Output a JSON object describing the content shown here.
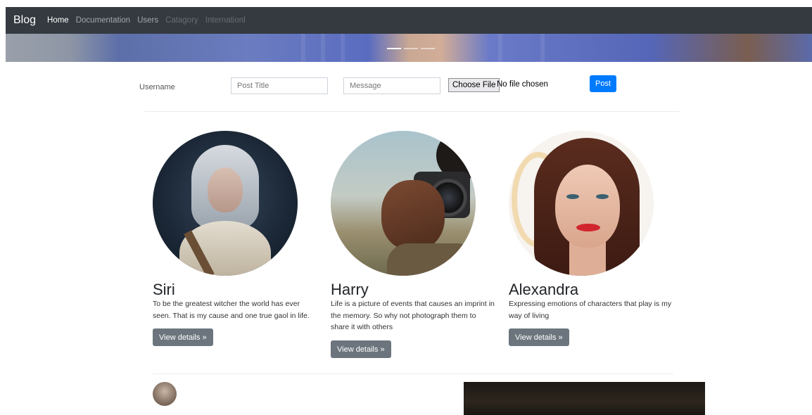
{
  "navbar": {
    "brand": "Blog",
    "links": [
      {
        "label": "Home",
        "state": "active"
      },
      {
        "label": "Documentation",
        "state": "normal"
      },
      {
        "label": "Users",
        "state": "normal"
      },
      {
        "label": "Catagory",
        "state": "disabled"
      },
      {
        "label": "Internationl",
        "state": "disabled"
      }
    ]
  },
  "carousel": {
    "indicator_count": 3,
    "active_index": 0
  },
  "post_form": {
    "username_label": "Username",
    "title_placeholder": "Post Title",
    "message_placeholder": "Message",
    "file_button": "Choose File",
    "file_status": "No file chosen",
    "submit_label": "Post"
  },
  "features": [
    {
      "name": "Siri",
      "text": "To be the greatest witcher the world has ever seen. That is my cause and one true gaol in life.",
      "button": "View details »"
    },
    {
      "name": "Harry",
      "text": "Life is a picture of events that causes an imprint in the memory. So why not photograph them to share it with others",
      "button": "View details »"
    },
    {
      "name": "Alexandra",
      "text": "Expressing emotions of characters that play is my way of living",
      "button": "View details »"
    }
  ],
  "colors": {
    "navbar": "#343a40",
    "primary": "#007bff",
    "secondary": "#6c757d"
  }
}
